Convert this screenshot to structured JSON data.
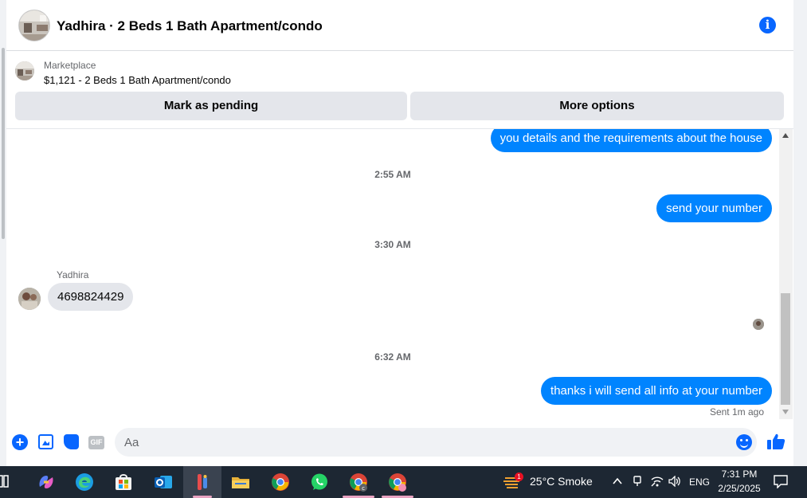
{
  "header": {
    "title": "Yadhira · 2 Beds 1 Bath Apartment/condo"
  },
  "marketplace": {
    "label": "Marketplace",
    "listing": "$1,121 - 2 Beds 1 Bath Apartment/condo",
    "mark_pending": "Mark as pending",
    "more_options": "More options"
  },
  "messages": {
    "partial_out": "you details and the requirements about the house",
    "ts1": "2:55 AM",
    "msg_send_number": "send your number",
    "ts2": "3:30 AM",
    "sender_name": "Yadhira",
    "msg_number": "4698824429",
    "ts3": "6:32 AM",
    "msg_thanks": "thanks i will send all info at your number",
    "sent_status": "Sent 1m ago"
  },
  "composer": {
    "placeholder": "Aa",
    "gif_label": "GIF"
  },
  "taskbar": {
    "weather_badge": "1",
    "weather": "25°C  Smoke",
    "language": "ENG",
    "time": "7:31 PM",
    "date": "2/25/2025"
  },
  "colors": {
    "accent": "#0866ff",
    "outgoing_bubble": "#0084ff",
    "incoming_bubble": "#e4e6eb",
    "taskbar": "#1d2733"
  },
  "icons": [
    "info-icon",
    "plus-icon",
    "photo-icon",
    "sticker-icon",
    "gif-icon",
    "emoji-icon",
    "like-icon"
  ]
}
